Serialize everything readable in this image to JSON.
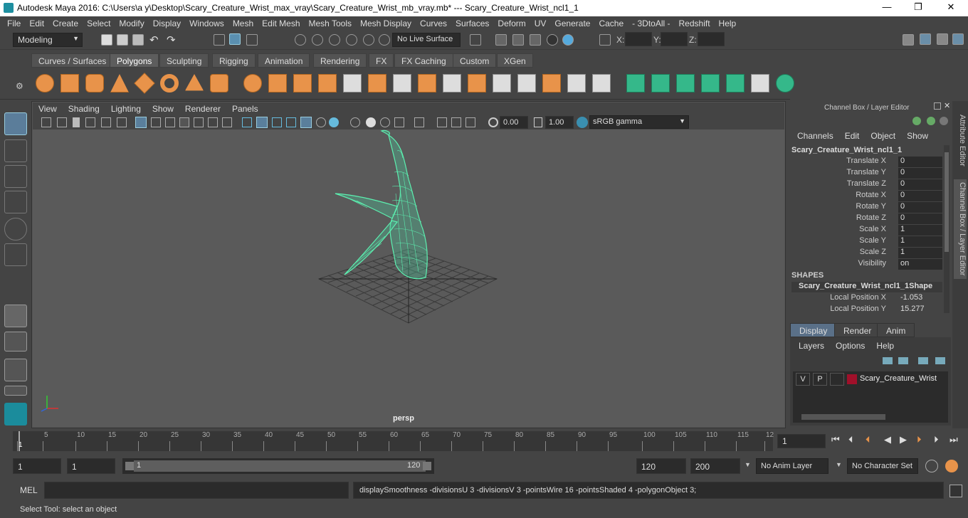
{
  "window": {
    "title": "Autodesk Maya 2016: C:\\Users\\a y\\Desktop\\Scary_Creature_Wrist_max_vray\\Scary_Creature_Wrist_mb_vray.mb*   ---   Scary_Creature_Wrist_ncl1_1",
    "minimize": "—",
    "maximize": "❐",
    "close": "✕"
  },
  "menubar": [
    "File",
    "Edit",
    "Create",
    "Select",
    "Modify",
    "Display",
    "Windows",
    "Mesh",
    "Edit Mesh",
    "Mesh Tools",
    "Mesh Display",
    "Curves",
    "Surfaces",
    "Deform",
    "UV",
    "Generate",
    "Cache",
    "- 3DtoAll -",
    "Redshift",
    "Help"
  ],
  "status": {
    "mode": "Modeling",
    "live_surface": "No Live Surface",
    "x_label": "X:",
    "y_label": "Y:",
    "z_label": "Z:"
  },
  "shelf_tabs": [
    {
      "label": "Curves / Surfaces",
      "active": false
    },
    {
      "label": "Polygons",
      "active": true
    },
    {
      "label": "Sculpting",
      "active": false
    },
    {
      "label": "Rigging",
      "active": false
    },
    {
      "label": "Animation",
      "active": false
    },
    {
      "label": "Rendering",
      "active": false
    },
    {
      "label": "FX",
      "active": false
    },
    {
      "label": "FX Caching",
      "active": false
    },
    {
      "label": "Custom",
      "active": false
    },
    {
      "label": "XGen",
      "active": false
    }
  ],
  "panel_menu": [
    "View",
    "Shading",
    "Lighting",
    "Show",
    "Renderer",
    "Panels"
  ],
  "panel_tools": {
    "exposure": "0.00",
    "gamma": "1.00",
    "color_space": "sRGB gamma"
  },
  "viewport": {
    "camera": "persp",
    "mesh_color": "#5cf0b0"
  },
  "channel_box": {
    "header": "Channel Box / Layer Editor",
    "menus": [
      "Channels",
      "Edit",
      "Object",
      "Show"
    ],
    "object": "Scary_Creature_Wrist_ncl1_1",
    "attrs": [
      {
        "label": "Translate X",
        "value": "0"
      },
      {
        "label": "Translate Y",
        "value": "0"
      },
      {
        "label": "Translate Z",
        "value": "0"
      },
      {
        "label": "Rotate X",
        "value": "0"
      },
      {
        "label": "Rotate Y",
        "value": "0"
      },
      {
        "label": "Rotate Z",
        "value": "0"
      },
      {
        "label": "Scale X",
        "value": "1"
      },
      {
        "label": "Scale Y",
        "value": "1"
      },
      {
        "label": "Scale Z",
        "value": "1"
      },
      {
        "label": "Visibility",
        "value": "on"
      }
    ],
    "shapes_header": "SHAPES",
    "shape_name": "Scary_Creature_Wrist_ncl1_1Shape",
    "shape_attrs": [
      {
        "label": "Local Position X",
        "value": "-1.053"
      },
      {
        "label": "Local Position Y",
        "value": "15.277"
      }
    ]
  },
  "layer_editor": {
    "tabs": [
      "Display",
      "Render",
      "Anim"
    ],
    "menus": [
      "Layers",
      "Options",
      "Help"
    ],
    "layer": {
      "v": "V",
      "p": "P",
      "name": "Scary_Creature_Wrist",
      "color": "#a0102a"
    }
  },
  "side_tabs": [
    "Attribute Editor",
    "Channel Box / Layer Editor"
  ],
  "timeline": {
    "ticks": [
      "1",
      "5",
      "10",
      "15",
      "20",
      "25",
      "30",
      "35",
      "40",
      "45",
      "50",
      "55",
      "60",
      "65",
      "70",
      "75",
      "80",
      "85",
      "90",
      "95",
      "100",
      "105",
      "110",
      "115",
      "12"
    ],
    "current_frame": "1"
  },
  "range": {
    "start": "1",
    "playback_start": "1",
    "slider_start": "1",
    "slider_end": "120",
    "playback_end": "120",
    "end": "200",
    "anim_layer": "No Anim Layer",
    "character_set": "No Character Set"
  },
  "cmd": {
    "label": "MEL",
    "result": "displaySmoothness -divisionsU 3 -divisionsV 3 -pointsWire 16 -pointsShaded 4 -polygonObject 3;"
  },
  "help_line": "Select Tool: select an object"
}
